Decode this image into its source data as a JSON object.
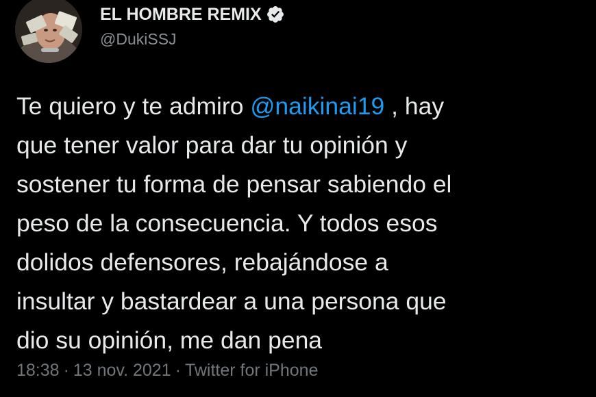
{
  "author": {
    "display_name": "EL HOMBRE REMIX",
    "handle": "@DukiSSJ"
  },
  "tweet": {
    "line1_before": "Te quiero y te admiro ",
    "mention": "@naikinai19",
    "line1_after": " , hay",
    "line2": "que tener valor para dar tu opinión y",
    "line3": "sostener tu forma de pensar sabiendo el",
    "line4": "peso de la consecuencia. Y todos esos",
    "line5": "dolidos defensores, rebajándose a",
    "line6": "insultar y bastardear a una persona que",
    "line7": "dio su opinión, me dan pena"
  },
  "meta": {
    "time": "18:38",
    "separator": "·",
    "date": "13 nov. 2021",
    "source": "Twitter for iPhone"
  },
  "colors": {
    "background": "#000000",
    "text": "#e7e9ea",
    "secondary": "#71767b",
    "link": "#1d9bf0"
  },
  "icons": {
    "verified": "verified-badge-icon"
  }
}
